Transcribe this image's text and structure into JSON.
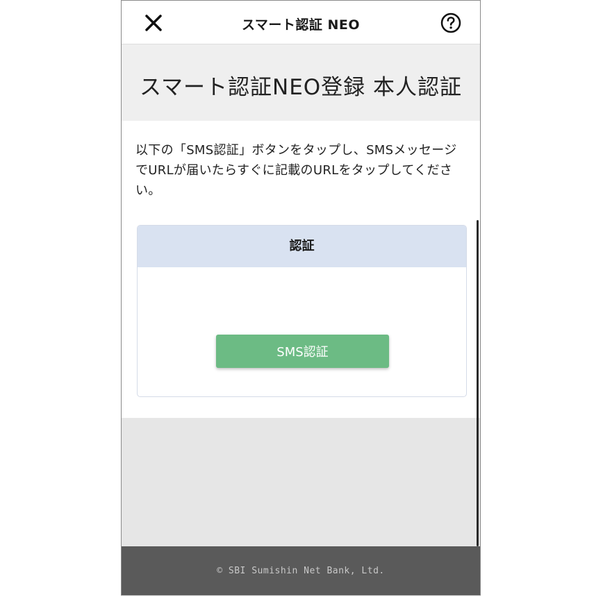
{
  "header": {
    "title": "スマート認証 NEO",
    "close_icon": "close-icon",
    "help_icon": "help-circle-icon"
  },
  "page": {
    "heading": "スマート認証NEO登録 本人認証",
    "instruction": "以下の「SMS認証」ボタンをタップし、SMSメッセージでURLが届いたらすぐに記載のURLをタップしてください。"
  },
  "auth_card": {
    "title": "認証",
    "button_label": "SMS認証"
  },
  "footer": {
    "copyright": "© SBI Sumishin Net Bank, Ltd."
  },
  "colors": {
    "button_green": "#6cbb84",
    "card_header": "#d9e2f1",
    "footer_bg": "#5a5a5a",
    "heading_band": "#efefef"
  }
}
